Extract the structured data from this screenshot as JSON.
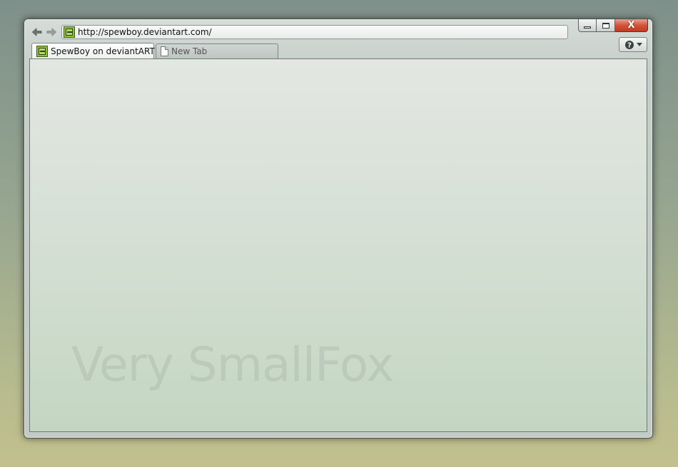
{
  "window": {
    "controls": {
      "minimize_icon": "minimize-icon",
      "maximize_icon": "maximize-icon",
      "close_glyph": "X"
    }
  },
  "toolbar": {
    "back_icon": "back-arrow-icon",
    "forward_icon": "forward-arrow-icon",
    "url": "http://spewboy.deviantart.com/",
    "site_icon": "deviantart-favicon-icon",
    "tools_icon": "help-menu-icon"
  },
  "tabs": [
    {
      "label": "SpewBoy on deviantART",
      "icon": "deviantart-favicon-icon",
      "active": true
    },
    {
      "label": "New Tab",
      "icon": "blank-page-icon",
      "active": false
    }
  ],
  "content": {
    "watermark": "Very SmallFox"
  },
  "colors": {
    "close_button": "#c23b22",
    "content_top": "#e3e7e2",
    "content_bottom": "#c4d6c2"
  }
}
